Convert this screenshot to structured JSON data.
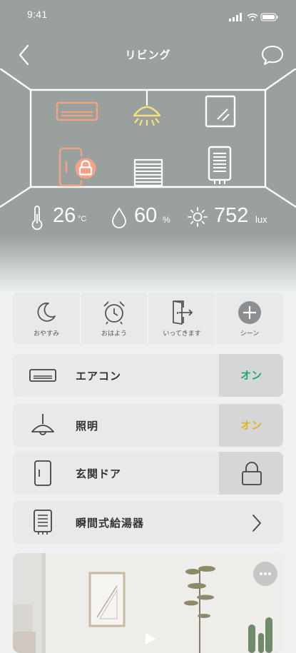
{
  "status_bar": {
    "time": "9:41"
  },
  "nav": {
    "title": "リビング"
  },
  "room": {
    "devices": [
      "air-conditioner",
      "ceiling-light",
      "window",
      "door-lock",
      "blind",
      "water-heater"
    ],
    "colors": {
      "active_ac": "#f2a384",
      "active_light": "#f5e27a",
      "line": "#ffffff"
    }
  },
  "environment": {
    "temperature": {
      "value": "26",
      "unit": "°C"
    },
    "humidity": {
      "value": "60",
      "unit": "%"
    },
    "illuminance": {
      "value": "752",
      "unit": "lux"
    }
  },
  "scenes": [
    {
      "label": "おやすみ",
      "icon": "moon-icon"
    },
    {
      "label": "おはよう",
      "icon": "alarm-clock-icon"
    },
    {
      "label": "いってきます",
      "icon": "door-exit-icon"
    },
    {
      "label": "シーン",
      "icon": "plus-circle-icon"
    }
  ],
  "devices": [
    {
      "name": "エアコン",
      "action": "オン",
      "action_color": "#27a86a",
      "icon": "air-conditioner-icon"
    },
    {
      "name": "照明",
      "action": "オン",
      "action_color": "#e0b41a",
      "icon": "pendant-light-icon"
    },
    {
      "name": "玄関ドア",
      "action": "",
      "icon": "door-icon",
      "action_icon": "lock-icon"
    },
    {
      "name": "瞬間式給湯器",
      "action": "",
      "icon": "water-heater-icon",
      "action_icon": "chevron-right-icon"
    }
  ]
}
